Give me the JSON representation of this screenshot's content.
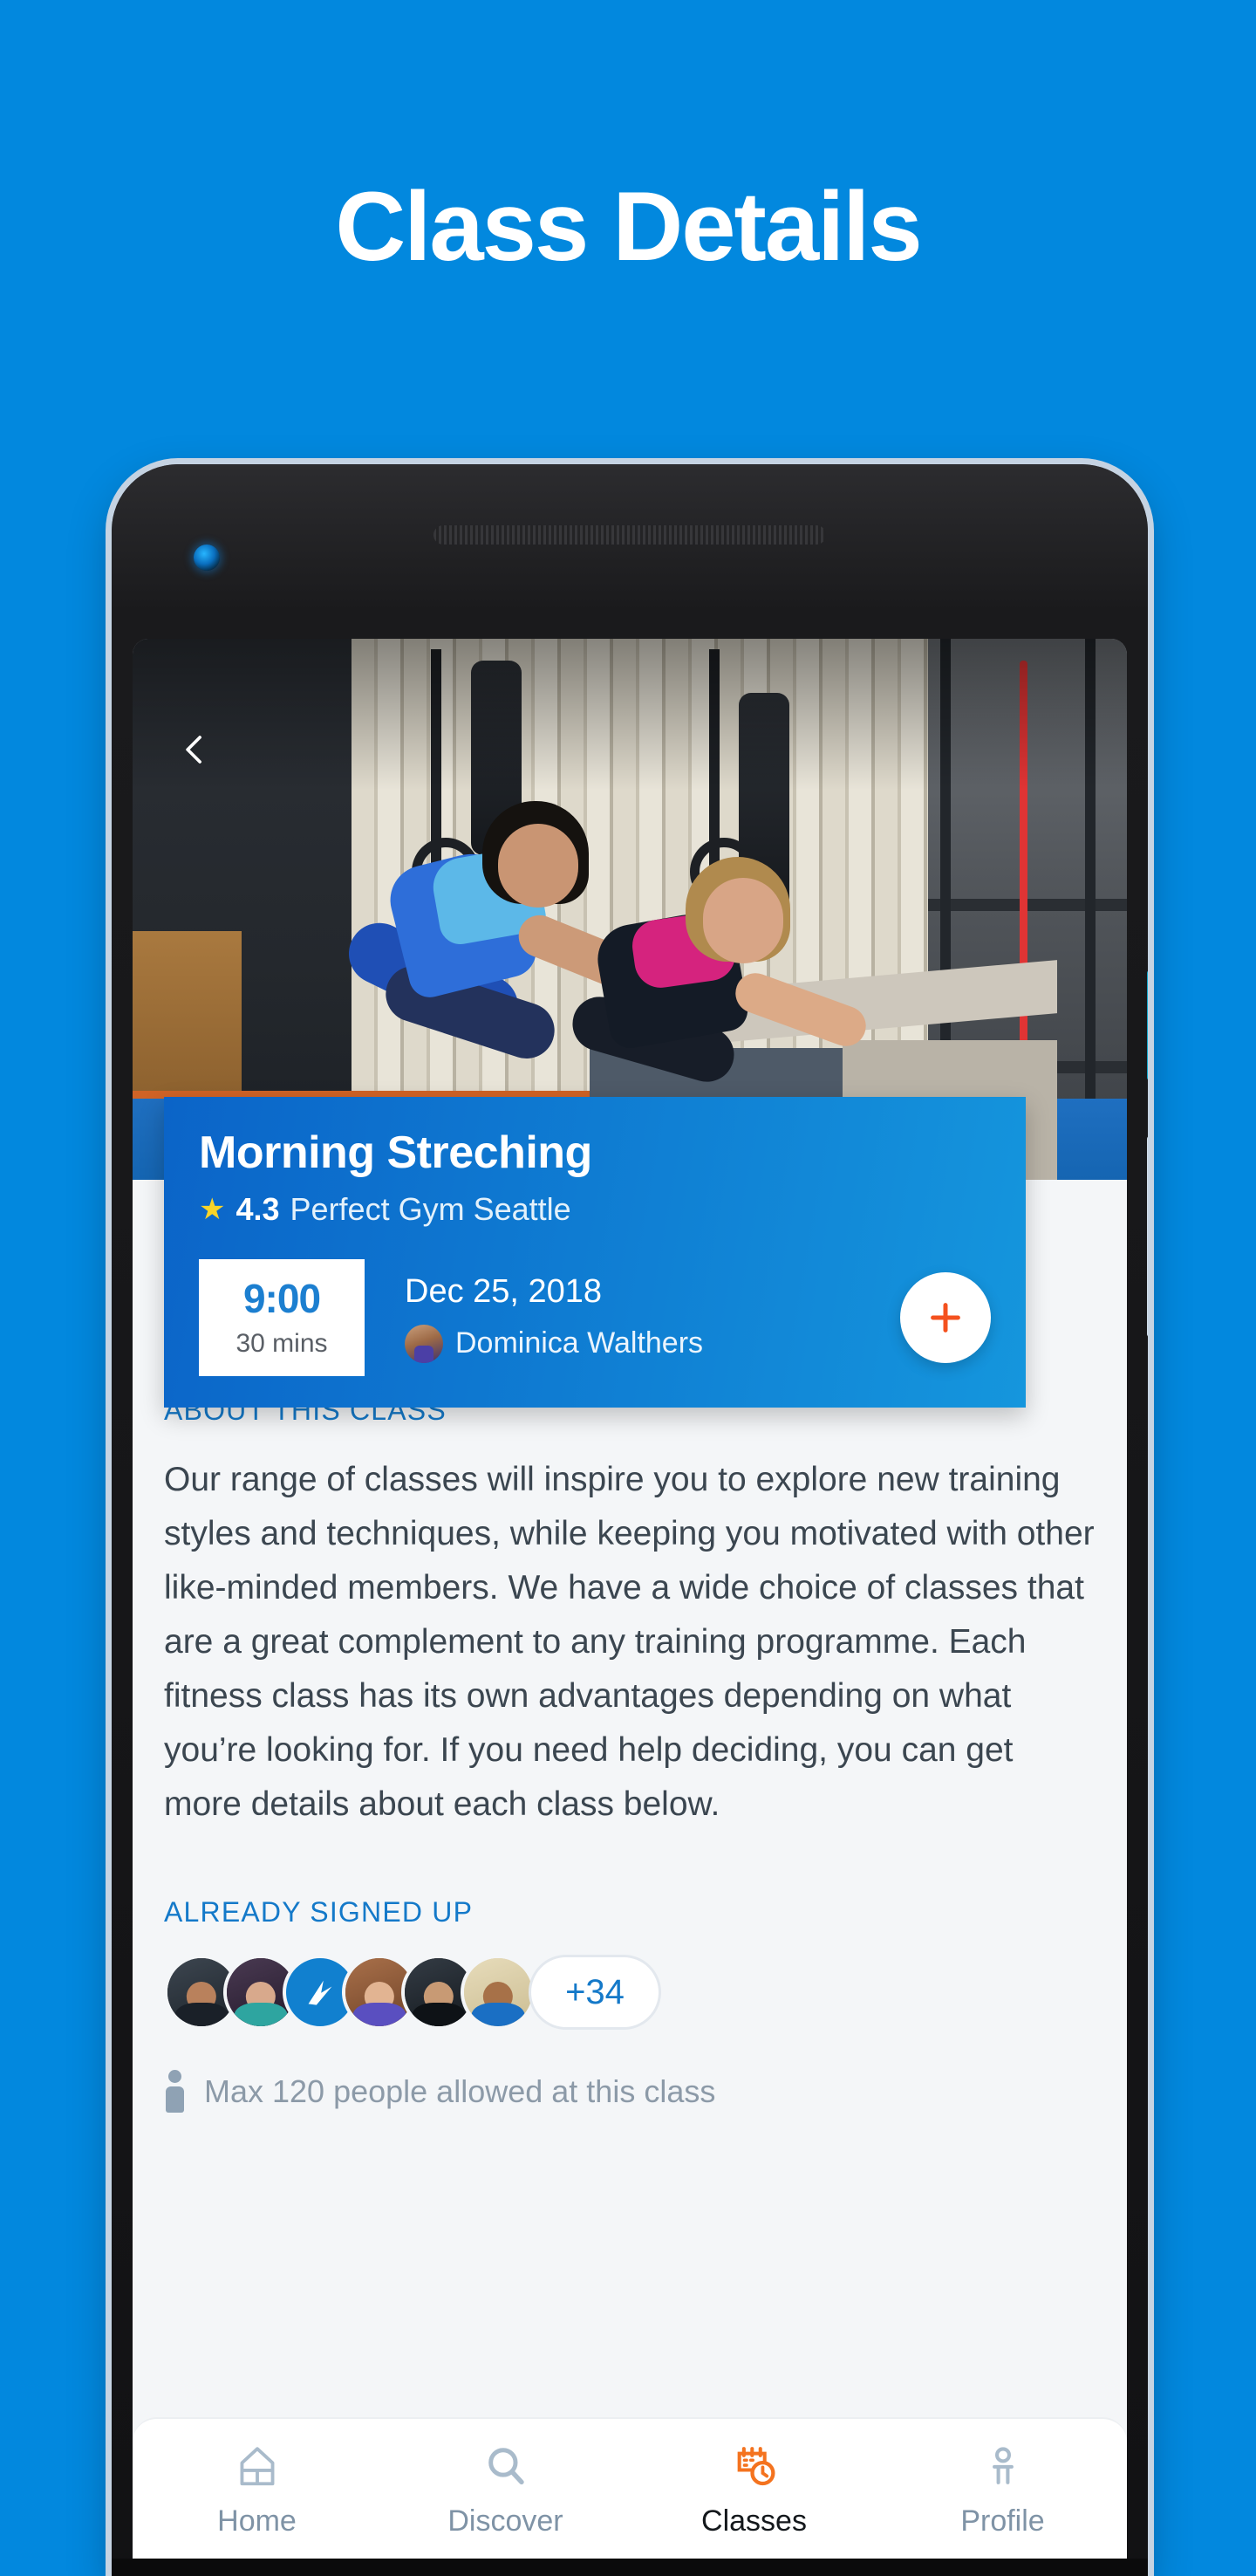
{
  "page": {
    "title": "Class Details",
    "background_color": "#0288de"
  },
  "screen": {
    "hero": {
      "back_icon": "chevron-left-icon",
      "image_alt": "two women doing push-ups on a plyo box in a gym"
    },
    "class_card": {
      "title": "Morning Streching",
      "star_icon": "star-icon",
      "rating": "4.3",
      "gym_name": "Perfect Gym Seattle",
      "time": "9:00",
      "duration": "30 mins",
      "date": "Dec 25, 2018",
      "instructor": "Dominica Walthers",
      "add_icon": "plus-icon",
      "accent_color": "#0f7cd2",
      "plus_color": "#f4511e"
    },
    "about": {
      "label": "ABOUT THIS CLASS",
      "text": "Our range of classes will inspire you to explore new training styles and techniques, while keeping you motivated with other like-minded members. We have a wide choice of classes that are a great complement to any training programme. Each fitness class has its own advantages depending on what you’re looking for. If you need help deciding, you can get more details about each class below."
    },
    "signed_up": {
      "label": "ALREADY SIGNED UP",
      "attendees": [
        {
          "name": "attendee-1",
          "type": "photo"
        },
        {
          "name": "attendee-2",
          "type": "photo"
        },
        {
          "name": "attendee-3",
          "type": "brand"
        },
        {
          "name": "attendee-4",
          "type": "photo"
        },
        {
          "name": "attendee-5",
          "type": "photo"
        },
        {
          "name": "attendee-6",
          "type": "photo"
        }
      ],
      "more_count": "+34",
      "capacity_icon": "person-icon",
      "capacity_text": "Max 120 people allowed at this class"
    },
    "bottom_nav": {
      "items": [
        {
          "label": "Home",
          "icon": "home-icon",
          "active": false
        },
        {
          "label": "Discover",
          "icon": "search-icon",
          "active": false
        },
        {
          "label": "Classes",
          "icon": "calendar-clock-icon",
          "active": true
        },
        {
          "label": "Profile",
          "icon": "person-icon",
          "active": false
        }
      ],
      "active_color": "#f4731f",
      "inactive_color": "#7f93a6"
    }
  }
}
